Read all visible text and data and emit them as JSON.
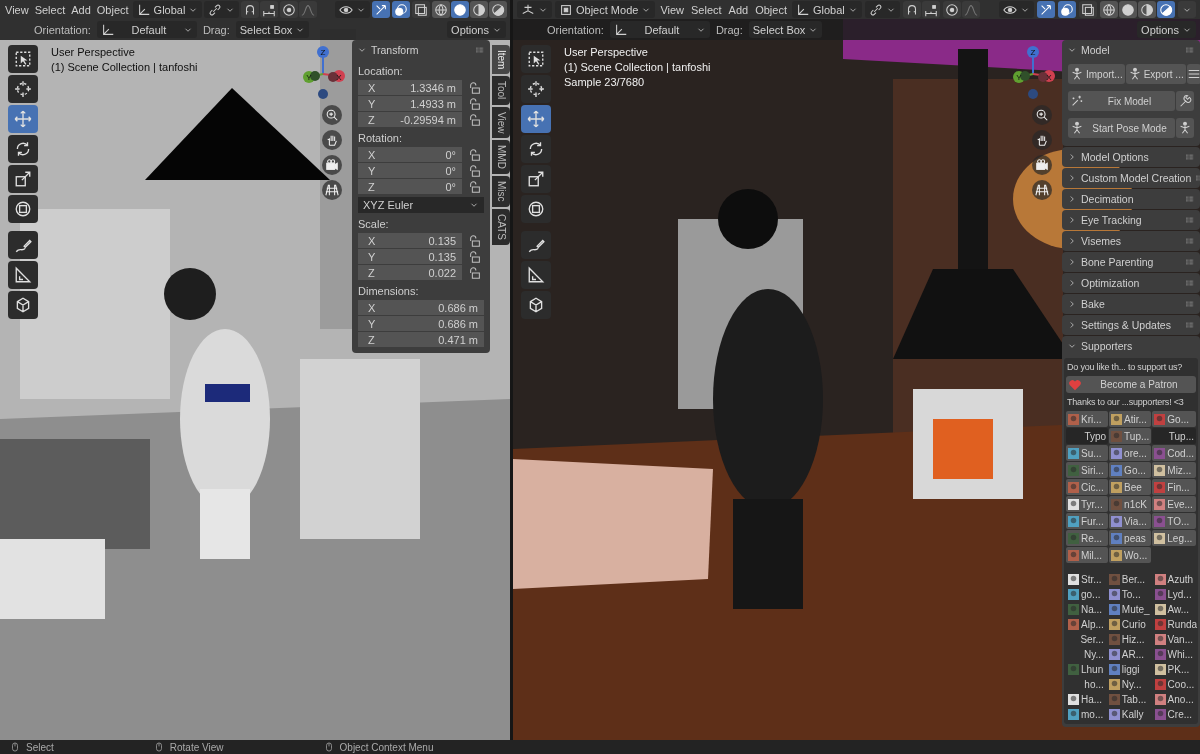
{
  "views": [
    {
      "menus": [
        "View",
        "Select",
        "Add",
        "Object"
      ],
      "orientation_global": "Global",
      "toggles": [
        {
          "kind": "gizmo",
          "on": true
        },
        {
          "kind": "overlay",
          "on": true
        },
        {
          "kind": "xray",
          "on": false
        }
      ],
      "shading": [
        {
          "kind": "wire",
          "selected": false
        },
        {
          "kind": "solid",
          "selected": true
        },
        {
          "kind": "material",
          "selected": false
        },
        {
          "kind": "rendered",
          "selected": false
        }
      ],
      "header2": {
        "orientation_label": "Orientation:",
        "orientation": "Default",
        "drag_label": "Drag:",
        "drag": "Select Box",
        "options": "Options"
      },
      "overlay": [
        "User Perspective",
        "(1) Scene Collection | tanfoshi"
      ],
      "gizmo_axes": [
        "Z",
        "Y",
        "X"
      ],
      "tools": [
        {
          "kind": "select-box",
          "selected": false
        },
        {
          "kind": "cursor",
          "selected": false
        },
        {
          "kind": "move",
          "selected": true
        },
        {
          "kind": "rotate",
          "selected": false
        },
        {
          "kind": "scale",
          "selected": false
        },
        {
          "kind": "transform",
          "selected": false
        },
        {
          "kind": "annotate",
          "selected": false
        },
        {
          "kind": "measure",
          "selected": false
        },
        {
          "kind": "add-cube",
          "selected": false
        }
      ],
      "panel": {
        "kind": "transform",
        "title": "Transform",
        "groups": [
          {
            "label": "Location:",
            "rows": [
              {
                "axis": "X",
                "value": "1.3346 m",
                "locked": false
              },
              {
                "axis": "Y",
                "value": "1.4933 m",
                "locked": false
              },
              {
                "axis": "Z",
                "value": "-0.29594 m",
                "locked": false
              }
            ]
          },
          {
            "label": "Rotation:",
            "rows": [
              {
                "axis": "X",
                "value": "0°",
                "locked": false
              },
              {
                "axis": "Y",
                "value": "0°",
                "locked": false
              },
              {
                "axis": "Z",
                "value": "0°",
                "locked": false
              }
            ],
            "dropdown": "XYZ Euler"
          },
          {
            "label": "Scale:",
            "rows": [
              {
                "axis": "X",
                "value": "0.135",
                "locked": false
              },
              {
                "axis": "Y",
                "value": "0.135",
                "locked": false
              },
              {
                "axis": "Z",
                "value": "0.022",
                "locked": false
              }
            ]
          },
          {
            "label": "Dimensions:",
            "rows": [
              {
                "axis": "X",
                "value": "0.686 m"
              },
              {
                "axis": "Y",
                "value": "0.686 m"
              },
              {
                "axis": "Z",
                "value": "0.471 m"
              }
            ]
          }
        ]
      },
      "tabs": [
        {
          "label": "Item",
          "selected": true
        },
        {
          "label": "Tool",
          "selected": false
        },
        {
          "label": "View",
          "selected": false
        },
        {
          "label": "MMD",
          "selected": false
        },
        {
          "label": "Misc",
          "selected": false
        },
        {
          "label": "CATS",
          "selected": false
        }
      ]
    },
    {
      "mode": "Object Mode",
      "menus": [
        "View",
        "Select",
        "Add",
        "Object"
      ],
      "orientation_global": "Global",
      "toggles": [
        {
          "kind": "gizmo",
          "on": true
        },
        {
          "kind": "overlay",
          "on": true
        },
        {
          "kind": "xray",
          "on": false
        }
      ],
      "shading": [
        {
          "kind": "wire",
          "selected": false
        },
        {
          "kind": "solid",
          "selected": false
        },
        {
          "kind": "material",
          "selected": false
        },
        {
          "kind": "rendered",
          "selected": true
        }
      ],
      "header2": {
        "orientation_label": "Orientation:",
        "orientation": "Default",
        "drag_label": "Drag:",
        "drag": "Select Box",
        "options": "Options"
      },
      "overlay": [
        "User Perspective",
        "(1) Scene Collection | tanfoshi",
        "Sample 23/7680"
      ],
      "gizmo_axes": [
        "Z",
        "Y",
        "X"
      ],
      "tools": [
        {
          "kind": "select-box",
          "selected": false
        },
        {
          "kind": "cursor",
          "selected": false
        },
        {
          "kind": "move",
          "selected": true
        },
        {
          "kind": "rotate",
          "selected": false
        },
        {
          "kind": "scale",
          "selected": false
        },
        {
          "kind": "transform",
          "selected": false
        },
        {
          "kind": "annotate",
          "selected": false
        },
        {
          "kind": "measure",
          "selected": false
        },
        {
          "kind": "add-cube",
          "selected": false
        }
      ],
      "panel": {
        "kind": "cats",
        "model": {
          "title": "Model",
          "expanded": true,
          "import": "Import...",
          "export": "Export ...",
          "fix": "Fix Model",
          "pose": "Start Pose Mode"
        },
        "sections": [
          {
            "title": "Model Options",
            "expanded": false
          },
          {
            "title": "Custom Model Creation",
            "expanded": false
          },
          {
            "title": "Decimation",
            "expanded": false
          },
          {
            "title": "Eye Tracking",
            "expanded": false
          },
          {
            "title": "Visemes",
            "expanded": false
          },
          {
            "title": "Bone Parenting",
            "expanded": false
          },
          {
            "title": "Optimization",
            "expanded": false
          },
          {
            "title": "Bake",
            "expanded": false
          },
          {
            "title": "Settings & Updates",
            "expanded": false
          }
        ],
        "supporters": {
          "title": "Supporters",
          "expanded": true,
          "question": "Do you like th... to support us?",
          "patron": "Become a Patron",
          "thanks": "Thanks to our ...supporters! <3",
          "groups": [
            [
              {
                "name": "Kri...",
                "kind": "avatar"
              },
              {
                "name": "Atir...",
                "kind": "avatar"
              },
              {
                "name": "Go...",
                "kind": "avatar"
              },
              {
                "name": "Typo",
                "kind": "plain"
              },
              {
                "name": "Tup...",
                "kind": "avatar"
              },
              {
                "name": "Tup...",
                "kind": "plain"
              },
              {
                "name": "Su...",
                "kind": "avatar"
              },
              {
                "name": "ore...",
                "kind": "avatar"
              },
              {
                "name": "Cod...",
                "kind": "avatar"
              },
              {
                "name": "Siri...",
                "kind": "avatar"
              },
              {
                "name": "Go...",
                "kind": "avatar"
              },
              {
                "name": "Miz...",
                "kind": "avatar"
              },
              {
                "name": "Cic...",
                "kind": "avatar"
              },
              {
                "name": "Bee",
                "kind": "avatar"
              },
              {
                "name": "Fin...",
                "kind": "avatar"
              },
              {
                "name": "Tyr...",
                "kind": "avatar"
              },
              {
                "name": "n1cK",
                "kind": "avatar"
              },
              {
                "name": "Eve...",
                "kind": "avatar"
              },
              {
                "name": "Fur...",
                "kind": "avatar"
              },
              {
                "name": "Via...",
                "kind": "avatar"
              },
              {
                "name": "TO...",
                "kind": "avatar"
              },
              {
                "name": "Re...",
                "kind": "avatar"
              },
              {
                "name": "peas",
                "kind": "avatar"
              },
              {
                "name": "Leg...",
                "kind": "avatar"
              },
              {
                "name": "Mil...",
                "kind": "avatar"
              },
              {
                "name": "Wo...",
                "kind": "avatar"
              }
            ],
            [
              {
                "name": "Str...",
                "kind": "avatar"
              },
              {
                "name": "Ber...",
                "kind": "avatar"
              },
              {
                "name": "Azuth",
                "kind": "avatar"
              },
              {
                "name": "go...",
                "kind": "avatar"
              },
              {
                "name": "To...",
                "kind": "avatar"
              },
              {
                "name": "Lyd...",
                "kind": "avatar"
              },
              {
                "name": "Na...",
                "kind": "avatar"
              },
              {
                "name": "Mute_",
                "kind": "avatar"
              },
              {
                "name": "Aw...",
                "kind": "avatar"
              },
              {
                "name": "Alp...",
                "kind": "avatar"
              },
              {
                "name": "Curio",
                "kind": "avatar"
              },
              {
                "name": "Runda",
                "kind": "avatar"
              },
              {
                "name": "Ser...",
                "kind": "plain"
              },
              {
                "name": "Hiz...",
                "kind": "avatar"
              },
              {
                "name": "Van...",
                "kind": "avatar"
              },
              {
                "name": "Ny...",
                "kind": "plain"
              },
              {
                "name": "AR...",
                "kind": "avatar"
              },
              {
                "name": "Whi...",
                "kind": "avatar"
              },
              {
                "name": "Lhun",
                "kind": "avatar"
              },
              {
                "name": "liggi",
                "kind": "avatar"
              },
              {
                "name": "PK...",
                "kind": "avatar"
              },
              {
                "name": "ho...",
                "kind": "plain"
              },
              {
                "name": "Ny...",
                "kind": "avatar"
              },
              {
                "name": "Coo...",
                "kind": "avatar"
              },
              {
                "name": "Ha...",
                "kind": "avatar"
              },
              {
                "name": "Tab...",
                "kind": "avatar"
              },
              {
                "name": "Ano...",
                "kind": "avatar"
              },
              {
                "name": "mo...",
                "kind": "avatar"
              },
              {
                "name": "Kally",
                "kind": "avatar"
              },
              {
                "name": "Cre...",
                "kind": "avatar"
              }
            ]
          ]
        }
      }
    }
  ],
  "status_bar": [
    {
      "label": "Select"
    },
    {
      "label": "Rotate View"
    },
    {
      "label": "Object Context Menu"
    }
  ]
}
